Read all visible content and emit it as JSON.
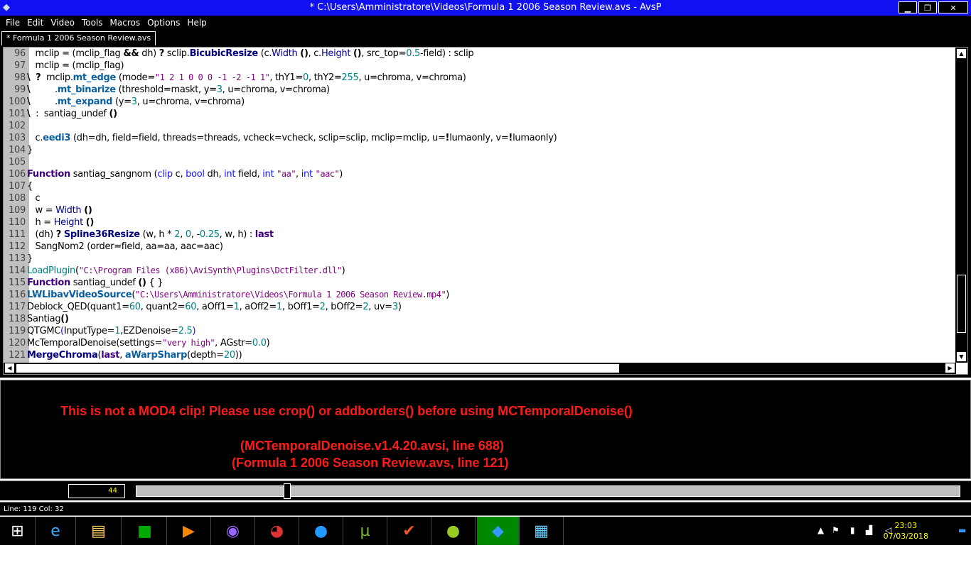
{
  "window": {
    "title": "* C:\\Users\\Amministratore\\Videos\\Formula 1 2006 Season Review.avs - AvsP",
    "minimize": "▁",
    "maximize": "❐",
    "close": "✕"
  },
  "menu": [
    "File",
    "Edit",
    "Video",
    "Tools",
    "Macros",
    "Options",
    "Help"
  ],
  "tab": "* Formula 1 2006 Season Review.avs",
  "code": [
    {
      "n": "96",
      "s": [
        [
          "d",
          "   mclip = (mclip_flag "
        ],
        [
          "op",
          "&&"
        ],
        [
          "d",
          " dh) "
        ],
        [
          "op",
          "?"
        ],
        [
          "d",
          " sclip."
        ],
        [
          "fnb",
          "BicubicResize"
        ],
        [
          "d",
          " (c."
        ],
        [
          "fi",
          "Width"
        ],
        [
          "d",
          " "
        ],
        [
          "op",
          "()"
        ],
        [
          "d",
          ", c."
        ],
        [
          "fi",
          "Height"
        ],
        [
          "d",
          " "
        ],
        [
          "op",
          "()"
        ],
        [
          "d",
          ", src_top="
        ],
        [
          "nu",
          "0.5"
        ],
        [
          "d",
          "-field) : sclip"
        ]
      ]
    },
    {
      "n": "97",
      "s": [
        [
          "d",
          "   mclip = (mclip_flag)"
        ]
      ]
    },
    {
      "n": "98",
      "s": [
        [
          "op",
          "\\"
        ],
        [
          "d",
          "  "
        ],
        [
          "op",
          "?"
        ],
        [
          "d",
          "  mclip."
        ],
        [
          "fn",
          "mt_edge"
        ],
        [
          "d",
          " (mode="
        ],
        [
          "st",
          "\"1 2 1 0 0 0 -1 -2 -1 1\""
        ],
        [
          "d",
          ", thY1="
        ],
        [
          "nu",
          "0"
        ],
        [
          "d",
          ", thY2="
        ],
        [
          "nu",
          "255"
        ],
        [
          "d",
          ", u=chroma, v=chroma)"
        ]
      ]
    },
    {
      "n": "99",
      "s": [
        [
          "op",
          "\\"
        ],
        [
          "d",
          "         ."
        ],
        [
          "fn",
          "mt_binarize"
        ],
        [
          "d",
          " (threshold=maskt, y="
        ],
        [
          "nu",
          "3"
        ],
        [
          "d",
          ", u=chroma, v=chroma)"
        ]
      ]
    },
    {
      "n": "100",
      "s": [
        [
          "op",
          "\\"
        ],
        [
          "d",
          "         ."
        ],
        [
          "fn",
          "mt_expand"
        ],
        [
          "d",
          " (y="
        ],
        [
          "nu",
          "3"
        ],
        [
          "d",
          ", u=chroma, v=chroma)"
        ]
      ]
    },
    {
      "n": "101",
      "s": [
        [
          "op",
          "\\"
        ],
        [
          "d",
          "  :  santiag_undef "
        ],
        [
          "op",
          "()"
        ]
      ]
    },
    {
      "n": "102",
      "s": []
    },
    {
      "n": "103",
      "s": [
        [
          "d",
          "   c."
        ],
        [
          "fn",
          "eedi3"
        ],
        [
          "d",
          " (dh=dh, field=field, threads=threads, vcheck=vcheck, sclip=sclip, mclip=mclip, u="
        ],
        [
          "op",
          "!"
        ],
        [
          "d",
          "lumaonly, v="
        ],
        [
          "op",
          "!"
        ],
        [
          "d",
          "lumaonly)"
        ]
      ]
    },
    {
      "n": "104",
      "s": [
        [
          "d",
          "}"
        ]
      ]
    },
    {
      "n": "105",
      "s": []
    },
    {
      "n": "106",
      "s": [
        [
          "kw",
          "Function"
        ],
        [
          "d",
          " santiag_sangnom ("
        ],
        [
          "ty",
          "clip"
        ],
        [
          "d",
          " c, "
        ],
        [
          "ty",
          "bool"
        ],
        [
          "d",
          " dh, "
        ],
        [
          "ty",
          "int"
        ],
        [
          "d",
          " field, "
        ],
        [
          "ty",
          "int"
        ],
        [
          "d",
          " "
        ],
        [
          "st",
          "\"aa\""
        ],
        [
          "d",
          ", "
        ],
        [
          "ty",
          "int"
        ],
        [
          "d",
          " "
        ],
        [
          "st",
          "\"aac\""
        ],
        [
          "d",
          ")"
        ]
      ]
    },
    {
      "n": "107",
      "s": [
        [
          "d",
          "{"
        ]
      ]
    },
    {
      "n": "108",
      "s": [
        [
          "d",
          "   c"
        ]
      ]
    },
    {
      "n": "109",
      "s": [
        [
          "d",
          "   w = "
        ],
        [
          "fi",
          "Width"
        ],
        [
          "d",
          " "
        ],
        [
          "op",
          "()"
        ]
      ]
    },
    {
      "n": "110",
      "s": [
        [
          "d",
          "   h = "
        ],
        [
          "fi",
          "Height"
        ],
        [
          "d",
          " "
        ],
        [
          "op",
          "()"
        ]
      ]
    },
    {
      "n": "111",
      "s": [
        [
          "d",
          "   (dh) "
        ],
        [
          "op",
          "?"
        ],
        [
          "d",
          " "
        ],
        [
          "fnb",
          "Spline36Resize"
        ],
        [
          "d",
          " (w, h * "
        ],
        [
          "nu",
          "2"
        ],
        [
          "d",
          ", "
        ],
        [
          "nu",
          "0"
        ],
        [
          "d",
          ", -"
        ],
        [
          "nu",
          "0.25"
        ],
        [
          "d",
          ", w, h) : "
        ],
        [
          "kw",
          "last"
        ]
      ]
    },
    {
      "n": "112",
      "s": [
        [
          "d",
          "   SangNom2 (order=field, aa=aa, aac=aac)"
        ]
      ]
    },
    {
      "n": "113",
      "s": [
        [
          "d",
          "}"
        ]
      ]
    },
    {
      "n": "114",
      "s": [
        [
          "pl",
          "LoadPlugin"
        ],
        [
          "d",
          "("
        ],
        [
          "st",
          "\"C:\\Program Files (x86)\\AviSynth\\Plugins\\DctFilter.dll\""
        ],
        [
          "d",
          ")"
        ]
      ]
    },
    {
      "n": "115",
      "s": [
        [
          "kw",
          "Function"
        ],
        [
          "d",
          " santiag_undef "
        ],
        [
          "op",
          "()"
        ],
        [
          "d",
          " { }"
        ]
      ]
    },
    {
      "n": "116",
      "s": [
        [
          "fn",
          "LWLibavVideoSource"
        ],
        [
          "d",
          "("
        ],
        [
          "st",
          "\"C:\\Users\\Amministratore\\Videos\\Formula 1 2006 Season Review.mp4\""
        ],
        [
          "d",
          ")"
        ]
      ]
    },
    {
      "n": "117",
      "s": [
        [
          "d",
          "Deblock_QED(quant1="
        ],
        [
          "nu",
          "60"
        ],
        [
          "d",
          ", quant2="
        ],
        [
          "nu",
          "60"
        ],
        [
          "d",
          ", aOff1="
        ],
        [
          "nu",
          "1"
        ],
        [
          "d",
          ", aOff2="
        ],
        [
          "nu",
          "1"
        ],
        [
          "d",
          ", bOff1="
        ],
        [
          "nu",
          "2"
        ],
        [
          "d",
          ", bOff2="
        ],
        [
          "nu",
          "2"
        ],
        [
          "d",
          ", uv="
        ],
        [
          "nu",
          "3"
        ],
        [
          "d",
          ")"
        ]
      ]
    },
    {
      "n": "118",
      "s": [
        [
          "d",
          "Santiag"
        ],
        [
          "op",
          "()"
        ]
      ]
    },
    {
      "n": "119",
      "s": [
        [
          "d",
          "QTGMC"
        ],
        [
          "par",
          "("
        ],
        [
          "d",
          "InputType="
        ],
        [
          "nu",
          "1"
        ],
        [
          "d",
          ",EZDenoise="
        ],
        [
          "nu",
          "2.5"
        ],
        [
          "par",
          ")"
        ]
      ]
    },
    {
      "n": "120",
      "s": [
        [
          "d",
          "McTemporalDenoise(settings="
        ],
        [
          "st",
          "\"very high\""
        ],
        [
          "d",
          ", AGstr="
        ],
        [
          "nu",
          "0.0"
        ],
        [
          "d",
          ")"
        ]
      ]
    },
    {
      "n": "121",
      "s": [
        [
          "fnb",
          "MergeChroma"
        ],
        [
          "d",
          "("
        ],
        [
          "kw",
          "last"
        ],
        [
          "d",
          ", "
        ],
        [
          "fn",
          "aWarpSharp"
        ],
        [
          "d",
          "(depth="
        ],
        [
          "nu",
          "20"
        ],
        [
          "d",
          "))"
        ]
      ]
    }
  ],
  "error": {
    "line1": "This is not a MOD4 clip! Please use crop() or addborders() before using MCTemporalDenoise()",
    "line2": "(MCTemporalDenoise.v1.4.20.avsi, line 688)",
    "line3": "(Formula 1 2006 Season Review.avs, line 121)"
  },
  "frame": "44",
  "slider_fraction": 0.18,
  "status": "Line: 119  Col: 32",
  "clock": {
    "time": "23:03",
    "date": "07/03/2018"
  }
}
